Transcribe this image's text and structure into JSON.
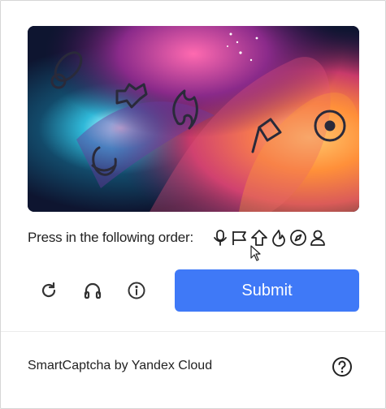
{
  "captcha": {
    "image": {
      "description_icons": [
        "bubble-icon",
        "puzzle-icon",
        "fire-icon",
        "mic-icon",
        "flag-icon",
        "eye-icon"
      ]
    },
    "prompt": "Press in the following order:",
    "order_icons": [
      "mic-icon",
      "flag-icon",
      "arrow-up-icon",
      "fire-icon",
      "compass-icon",
      "user-icon"
    ],
    "submit_label": "Submit"
  },
  "footer": {
    "brand": "SmartCaptcha by Yandex Cloud"
  },
  "colors": {
    "accent": "#3f79f7",
    "text": "#222222",
    "border": "#d6d6d6"
  }
}
